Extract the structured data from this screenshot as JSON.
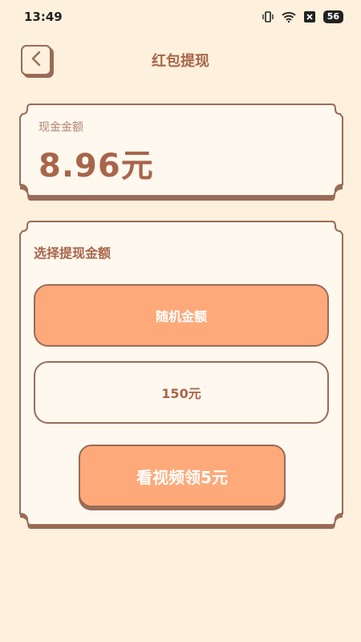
{
  "status_bar": {
    "time": "13:49",
    "battery": "56"
  },
  "header": {
    "title": "红包提现",
    "back_icon": "chevron-left-icon"
  },
  "cash_card": {
    "label": "现金金额",
    "amount": "8.96元"
  },
  "withdraw_card": {
    "section_title": "选择提现金额",
    "options": [
      {
        "label": "随机金额",
        "selected": true
      },
      {
        "label": "150元",
        "selected": false
      }
    ],
    "watch_button": "看视频领5元"
  },
  "colors": {
    "background": "#fdf0dc",
    "accent": "#fea97a",
    "border": "#9a6b57",
    "text": "#a8654a"
  }
}
